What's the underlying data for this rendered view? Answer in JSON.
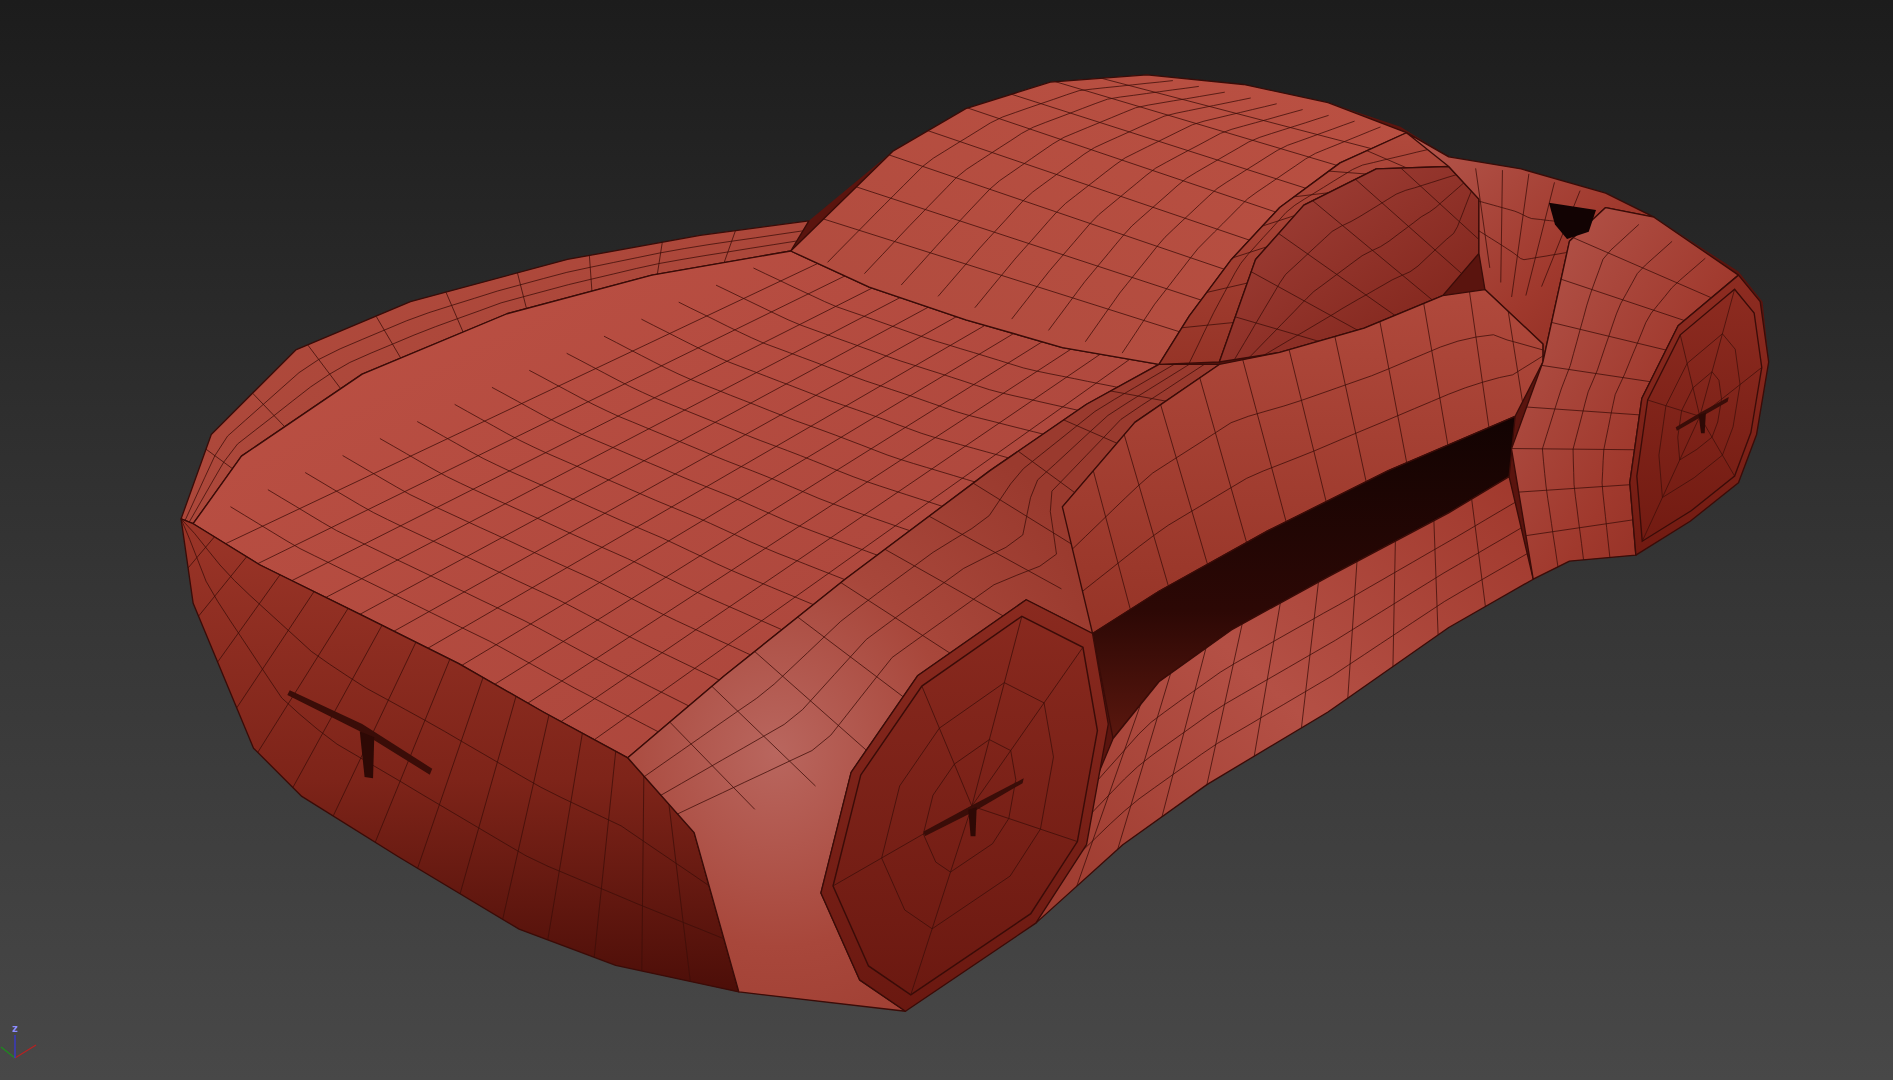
{
  "viewport": {
    "axis_gizmo": {
      "label": "z"
    }
  }
}
